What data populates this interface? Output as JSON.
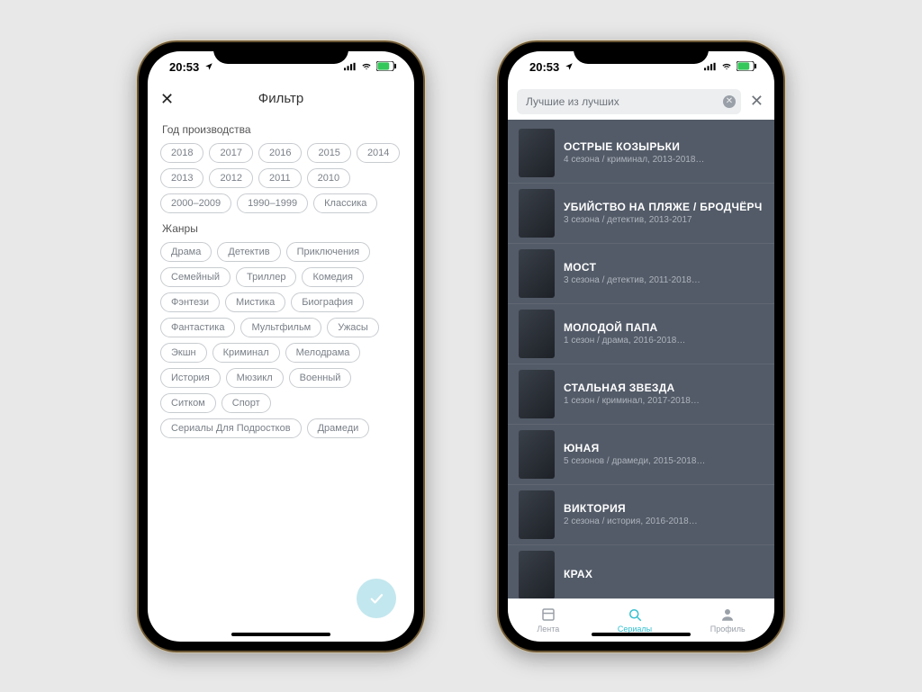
{
  "status": {
    "time": "20:53"
  },
  "left": {
    "title": "Фильтр",
    "year_label": "Год производства",
    "genres_label": "Жанры",
    "years": [
      "2018",
      "2017",
      "2016",
      "2015",
      "2014",
      "2013",
      "2012",
      "2011",
      "2010",
      "2000–2009",
      "1990–1999",
      "Классика"
    ],
    "genres": [
      "Драма",
      "Детектив",
      "Приключения",
      "Семейный",
      "Триллер",
      "Комедия",
      "Фэнтези",
      "Мистика",
      "Биография",
      "Фантастика",
      "Мультфильм",
      "Ужасы",
      "Экшн",
      "Криминал",
      "Мелодрама",
      "История",
      "Мюзикл",
      "Военный",
      "Ситком",
      "Спорт",
      "Сериалы Для Подростков",
      "Драмеди"
    ]
  },
  "right": {
    "search_value": "Лучшие из лучших",
    "items": [
      {
        "title": "ОСТРЫЕ КОЗЫРЬКИ",
        "sub": "4 сезона / криминал, 2013-2018…"
      },
      {
        "title": "УБИЙСТВО НА ПЛЯЖЕ / БРОДЧЁРЧ",
        "sub": "3 сезона / детектив, 2013-2017"
      },
      {
        "title": "МОСТ",
        "sub": "3 сезона / детектив, 2011-2018…"
      },
      {
        "title": "МОЛОДОЙ ПАПА",
        "sub": "1 сезон / драма, 2016-2018…"
      },
      {
        "title": "СТАЛЬНАЯ ЗВЕЗДА",
        "sub": "1 сезон / криминал, 2017-2018…"
      },
      {
        "title": "ЮНАЯ",
        "sub": "5 сезонов / драмеди, 2015-2018…"
      },
      {
        "title": "ВИКТОРИЯ",
        "sub": "2 сезона / история, 2016-2018…"
      },
      {
        "title": "КРАХ",
        "sub": ""
      }
    ],
    "tabs": {
      "feed": "Лента",
      "series": "Сериалы",
      "profile": "Профиль"
    }
  }
}
